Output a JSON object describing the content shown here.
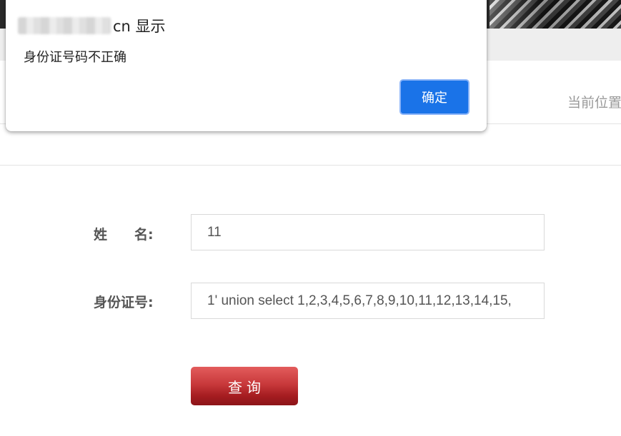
{
  "dialog": {
    "origin_suffix": "cn 显示",
    "message": "身份证号码不正确",
    "ok_label": "确定"
  },
  "header": {
    "location_label": "当前位置"
  },
  "form": {
    "name_label_char1": "姓",
    "name_label_char2": "名:",
    "name_value": "11",
    "id_label": "身份证号:",
    "id_value": "1' union select 1,2,3,4,5,6,7,8,9,10,11,12,13,14,15,",
    "submit_label": "查询"
  },
  "colors": {
    "dialog_button": "#1a73e8",
    "query_button": "#b8282c",
    "label_text": "#555555"
  }
}
